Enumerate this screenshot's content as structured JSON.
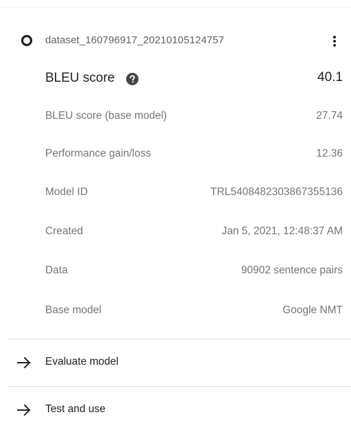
{
  "model": {
    "name": "dataset_160796917_20210105124757",
    "icon": "model-status-circle-icon",
    "more_icon": "more-vertical-icon"
  },
  "bleu": {
    "label": "BLEU score",
    "value": "40.1",
    "help_icon": "help-circle-icon"
  },
  "details": [
    {
      "label": "BLEU score (base model)",
      "value": "27.74"
    },
    {
      "label": "Performance gain/loss",
      "value": "12.36"
    },
    {
      "label": "Model ID",
      "value": "TRL5408482303867355136"
    },
    {
      "label": "Created",
      "value": "Jan 5, 2021, 12:48:37 AM"
    },
    {
      "label": "Data",
      "value": "90902 sentence pairs"
    },
    {
      "label": "Base model",
      "value": "Google NMT"
    }
  ],
  "actions": [
    {
      "label": "Evaluate model",
      "icon": "arrow-right-icon"
    },
    {
      "label": "Test and use",
      "icon": "arrow-right-icon"
    }
  ],
  "colors": {
    "primary_text": "#202124",
    "secondary_text": "#757575",
    "divider": "#dcdcdc"
  }
}
